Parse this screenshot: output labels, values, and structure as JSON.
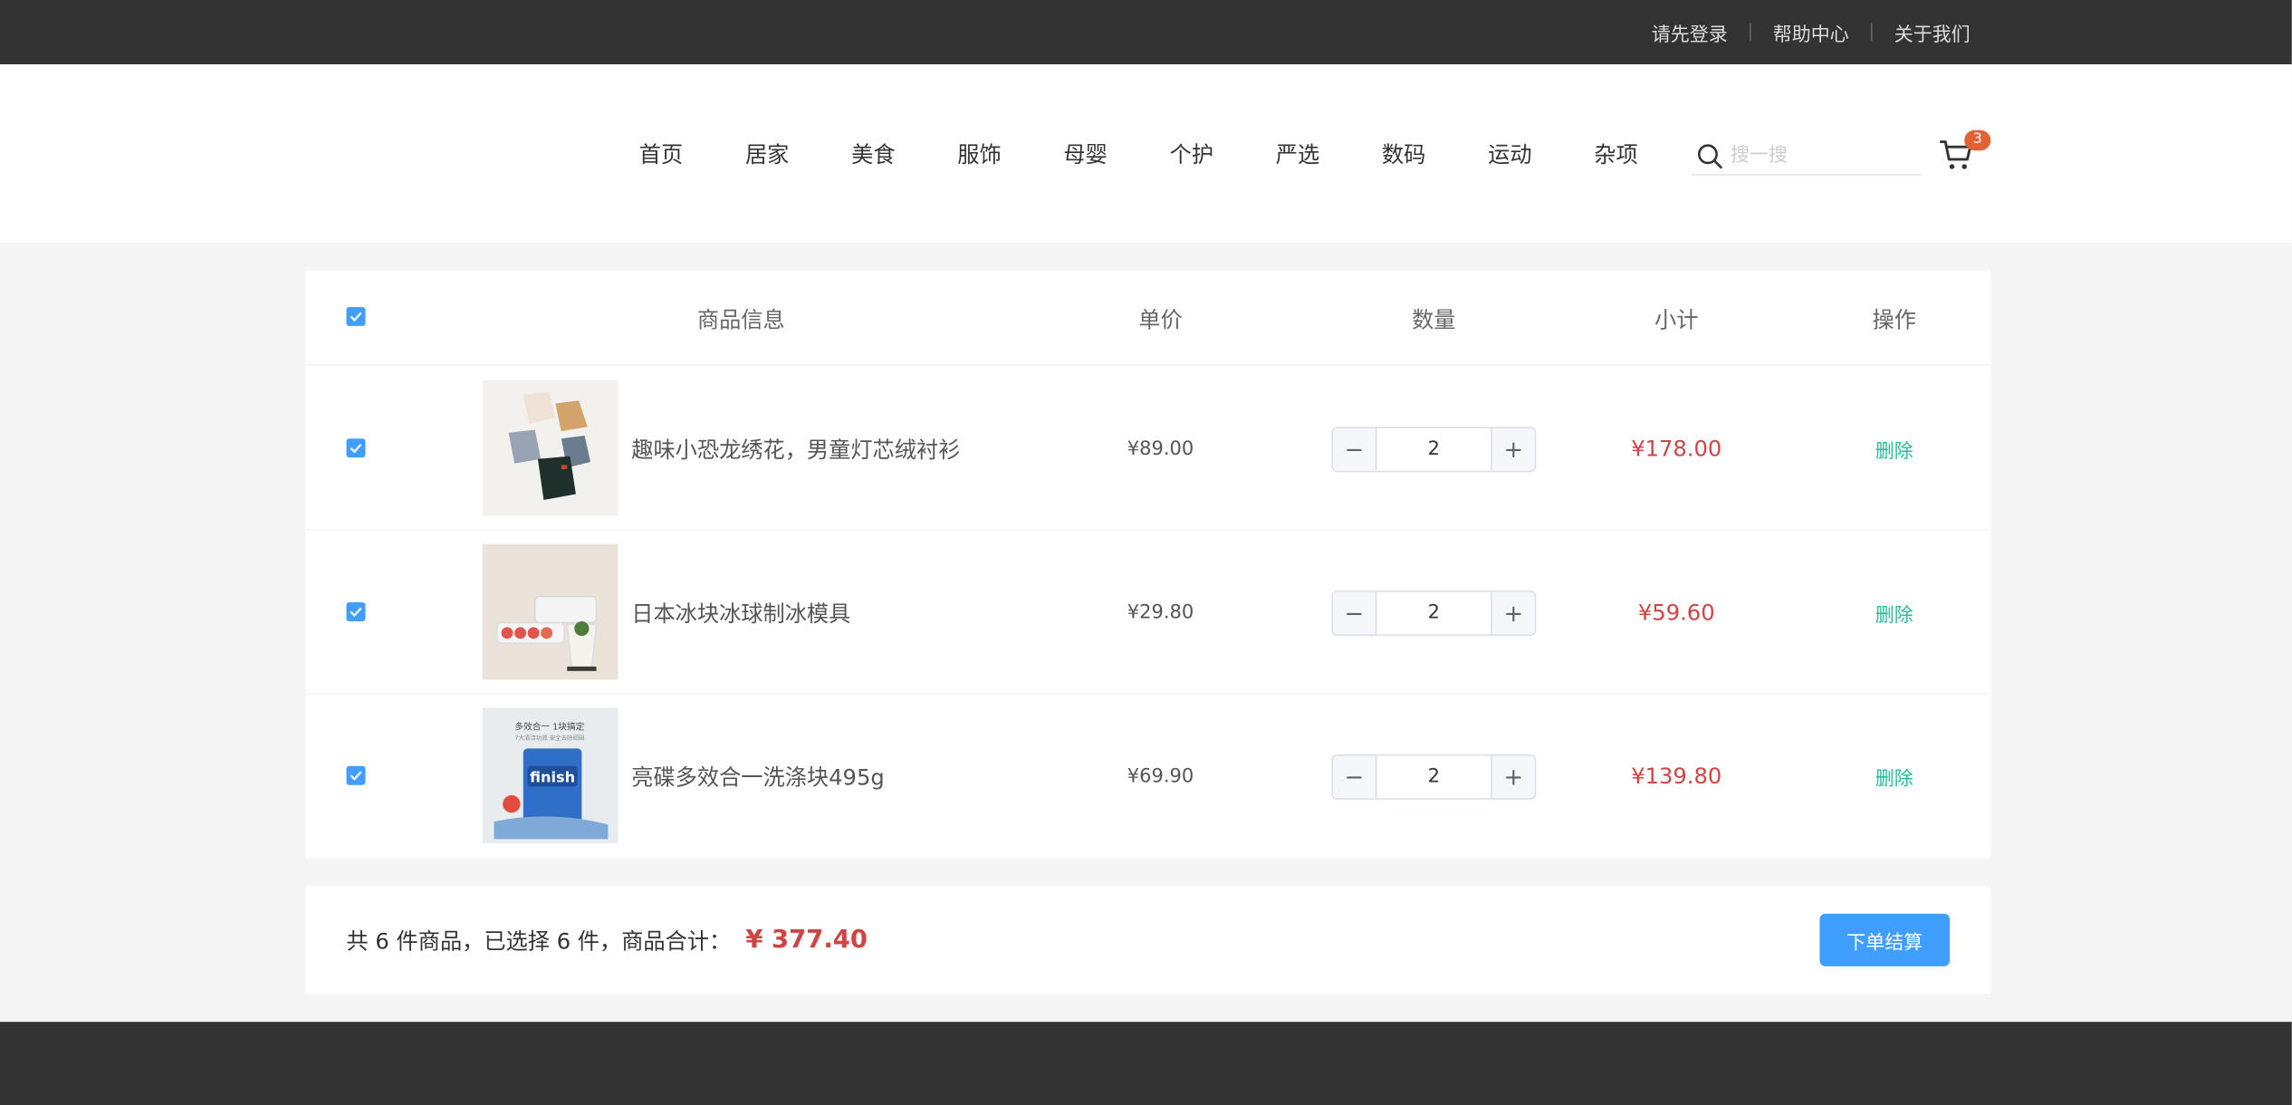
{
  "topbar": {
    "links": [
      "请先登录",
      "帮助中心",
      "关于我们"
    ]
  },
  "nav": {
    "items": [
      "首页",
      "居家",
      "美食",
      "服饰",
      "母婴",
      "个护",
      "严选",
      "数码",
      "运动",
      "杂项"
    ]
  },
  "search": {
    "placeholder": "搜一搜",
    "icon": "search-icon"
  },
  "cart": {
    "icon": "cart-icon",
    "badge": "3"
  },
  "table": {
    "headers": {
      "info": "商品信息",
      "price": "单价",
      "qty": "数量",
      "subtotal": "小计",
      "action": "操作"
    },
    "rows": [
      {
        "name": "趣味小恐龙绣花，男童灯芯绒衬衫",
        "price": "¥89.00",
        "qty": "2",
        "subtotal": "¥178.00",
        "action": "删除"
      },
      {
        "name": "日本冰块冰球制冰模具",
        "price": "¥29.80",
        "qty": "2",
        "subtotal": "¥59.60",
        "action": "删除"
      },
      {
        "name": "亮碟多效合一洗涤块495g",
        "price": "¥69.90",
        "qty": "2",
        "subtotal": "¥139.80",
        "action": "删除"
      }
    ],
    "thumb_text": {
      "line1": "多效合一 1块搞定",
      "line2": "7大清洁功效 安全去除顽固",
      "brand": "finish"
    }
  },
  "summary": {
    "text": "共 6 件商品，已选择 6 件，商品合计：",
    "total": "¥ 377.40",
    "checkout_label": "下单结算"
  },
  "colors": {
    "accent": "#409eff",
    "price_red": "#cf4444",
    "delete_green": "#27ba9b",
    "dark": "#333333"
  }
}
